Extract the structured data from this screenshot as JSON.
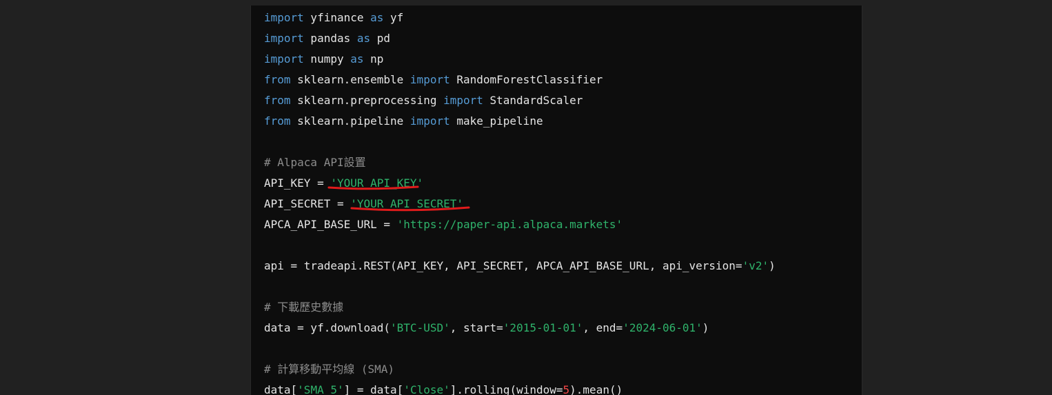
{
  "code": {
    "lines": [
      [
        {
          "k": "kw",
          "t": "import"
        },
        {
          "k": "plain",
          "t": " yfinance "
        },
        {
          "k": "kw",
          "t": "as"
        },
        {
          "k": "plain",
          "t": " yf"
        }
      ],
      [
        {
          "k": "kw",
          "t": "import"
        },
        {
          "k": "plain",
          "t": " pandas "
        },
        {
          "k": "kw",
          "t": "as"
        },
        {
          "k": "plain",
          "t": " pd"
        }
      ],
      [
        {
          "k": "kw",
          "t": "import"
        },
        {
          "k": "plain",
          "t": " numpy "
        },
        {
          "k": "kw",
          "t": "as"
        },
        {
          "k": "plain",
          "t": " np"
        }
      ],
      [
        {
          "k": "kw",
          "t": "from"
        },
        {
          "k": "plain",
          "t": " sklearn.ensemble "
        },
        {
          "k": "kw",
          "t": "import"
        },
        {
          "k": "plain",
          "t": " RandomForestClassifier"
        }
      ],
      [
        {
          "k": "kw",
          "t": "from"
        },
        {
          "k": "plain",
          "t": " sklearn.preprocessing "
        },
        {
          "k": "kw",
          "t": "import"
        },
        {
          "k": "plain",
          "t": " StandardScaler"
        }
      ],
      [
        {
          "k": "kw",
          "t": "from"
        },
        {
          "k": "plain",
          "t": " sklearn.pipeline "
        },
        {
          "k": "kw",
          "t": "import"
        },
        {
          "k": "plain",
          "t": " make_pipeline"
        }
      ],
      [],
      [
        {
          "k": "com",
          "t": "# Alpaca API設置"
        }
      ],
      [
        {
          "k": "plain",
          "t": "API_KEY = "
        },
        {
          "k": "str",
          "t": "'YOUR_API_KEY'"
        }
      ],
      [
        {
          "k": "plain",
          "t": "API_SECRET = "
        },
        {
          "k": "str",
          "t": "'YOUR_API_SECRET'"
        }
      ],
      [
        {
          "k": "plain",
          "t": "APCA_API_BASE_URL = "
        },
        {
          "k": "str",
          "t": "'https://paper-api.alpaca.markets'"
        }
      ],
      [],
      [
        {
          "k": "plain",
          "t": "api = tradeapi.REST(API_KEY, API_SECRET, APCA_API_BASE_URL, api_version="
        },
        {
          "k": "str",
          "t": "'v2'"
        },
        {
          "k": "plain",
          "t": ")"
        }
      ],
      [],
      [
        {
          "k": "com",
          "t": "# 下載歷史數據"
        }
      ],
      [
        {
          "k": "plain",
          "t": "data = yf.download("
        },
        {
          "k": "str",
          "t": "'BTC-USD'"
        },
        {
          "k": "plain",
          "t": ", start="
        },
        {
          "k": "str",
          "t": "'2015-01-01'"
        },
        {
          "k": "plain",
          "t": ", end="
        },
        {
          "k": "str",
          "t": "'2024-06-01'"
        },
        {
          "k": "plain",
          "t": ")"
        }
      ],
      [],
      [
        {
          "k": "com",
          "t": "# 計算移動平均線 (SMA)"
        }
      ],
      [
        {
          "k": "plain",
          "t": "data["
        },
        {
          "k": "str",
          "t": "'SMA_5'"
        },
        {
          "k": "plain",
          "t": "] = data["
        },
        {
          "k": "str",
          "t": "'Close'"
        },
        {
          "k": "plain",
          "t": "].rolling(window="
        },
        {
          "k": "num",
          "t": "5"
        },
        {
          "k": "plain",
          "t": ").mean()"
        }
      ]
    ]
  },
  "annotation_color": "#e01b1b"
}
